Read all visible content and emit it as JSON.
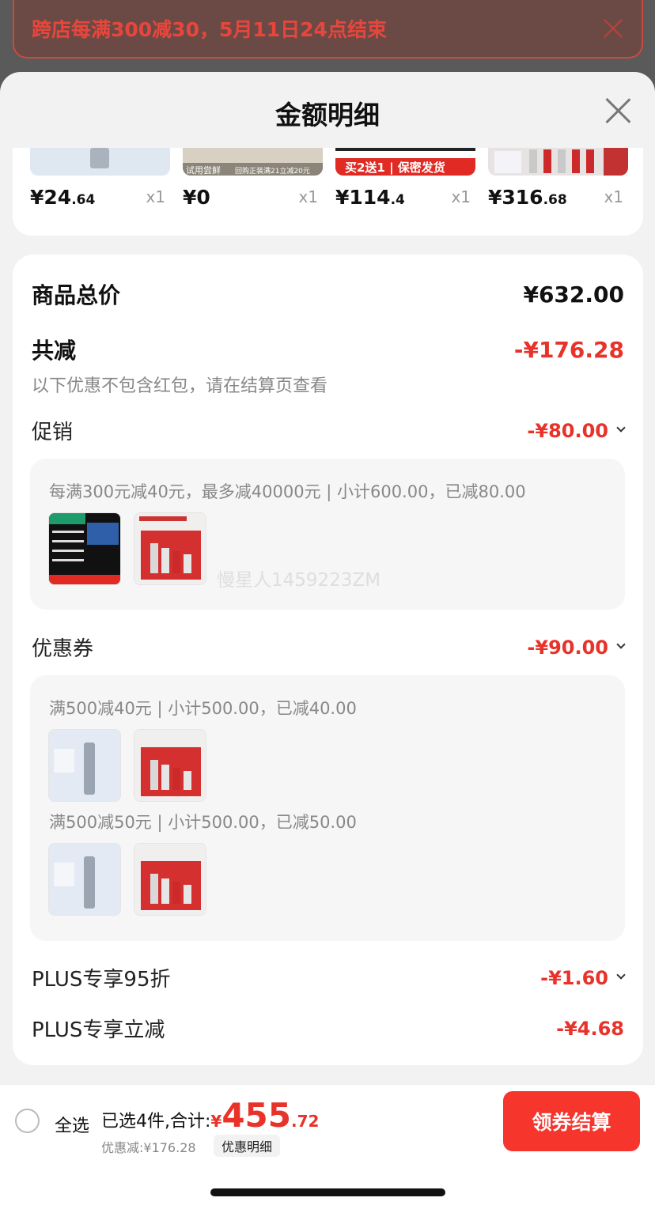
{
  "banner": {
    "text": "跨店每满300减30，5月11日24点结束"
  },
  "sheet": {
    "title": "金额明细"
  },
  "products": [
    {
      "price_int": "¥24",
      "price_dec": ".64",
      "qty": "x1"
    },
    {
      "price_int": "¥0",
      "price_dec": "",
      "qty": "x1",
      "tag": "试用尝鲜",
      "promo": "回购正装满21立减20元"
    },
    {
      "price_int": "¥114",
      "price_dec": ".4",
      "qty": "x1",
      "tag": "买2送1 | 保密发货"
    },
    {
      "price_int": "¥316",
      "price_dec": ".68",
      "qty": "x1"
    }
  ],
  "summary": {
    "total_label": "商品总价",
    "total_value": "¥632.00",
    "reduce_label": "共减",
    "reduce_value": "-¥176.28",
    "note": "以下优惠不包含红包，请在结算页查看"
  },
  "promotion": {
    "label": "促销",
    "value": "-¥80.00",
    "detail": "每满300元减40元，最多减40000元 | 小计600.00，已减80.00",
    "watermark": "慢星人1459223ZM"
  },
  "coupon": {
    "label": "优惠券",
    "value": "-¥90.00",
    "groups": [
      {
        "text": "满500减40元 | 小计500.00，已减40.00"
      },
      {
        "text": "满500减50元 | 小计500.00，已减50.00"
      }
    ]
  },
  "plus_discount": {
    "label": "PLUS专享95折",
    "value": "-¥1.60"
  },
  "plus_reduce": {
    "label": "PLUS专享立减",
    "value": "-¥4.68"
  },
  "footer": {
    "select_all": "全选",
    "selected_text": "已选4件,合计:",
    "currency": "¥",
    "total_int": "455",
    "total_dec": ".72",
    "discount_text": "优惠减:¥176.28",
    "detail_button": "优惠明细",
    "checkout_button": "领券结算"
  },
  "colors": {
    "accent": "#e8322a",
    "checkout": "#f6352d"
  },
  "icons": [
    "close-icon",
    "chevron-down-icon",
    "radio-icon"
  ]
}
